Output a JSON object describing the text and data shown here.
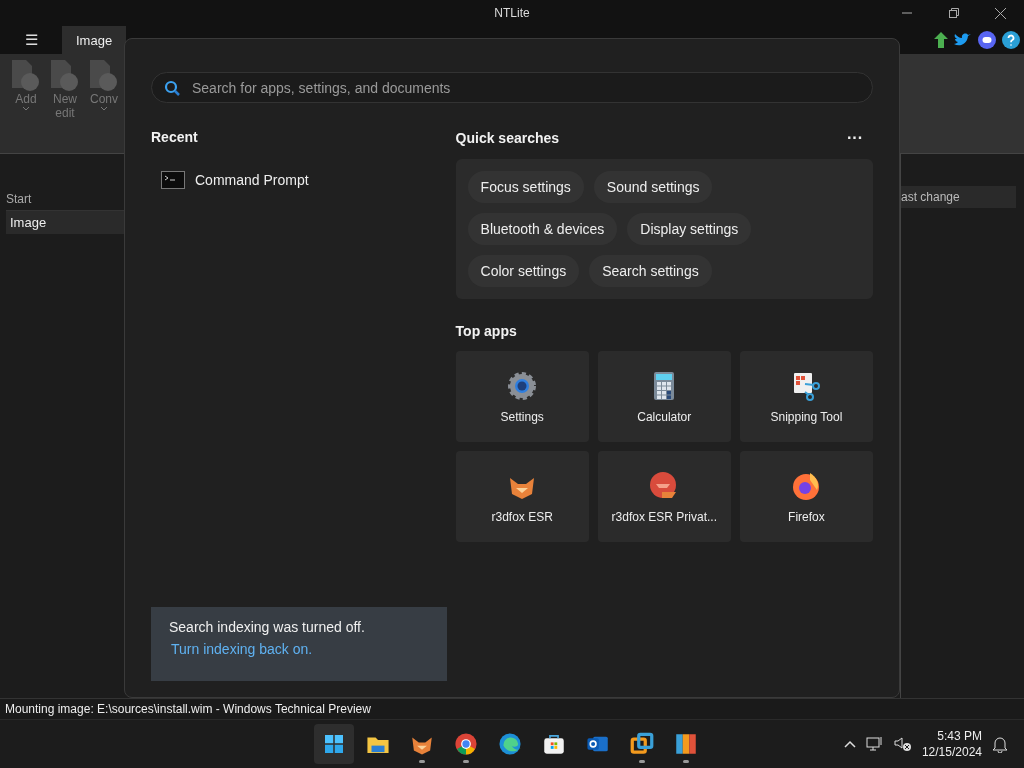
{
  "window": {
    "title": "NTLite"
  },
  "menu_button": "☰",
  "tabs": [
    {
      "label": "Image",
      "selected": true
    }
  ],
  "ribbon": [
    {
      "label": "Add",
      "dropdown": true
    },
    {
      "label": "New edit",
      "dropdown": false
    },
    {
      "label": "Conv",
      "dropdown": true
    }
  ],
  "left_pane": {
    "heading": "Start",
    "items": [
      {
        "label": "Image",
        "selected": true
      }
    ]
  },
  "right_pane": {
    "column_header": "ast change"
  },
  "status_bar": "Mounting image: E:\\sources\\install.wim - Windows Technical Preview",
  "search_panel": {
    "placeholder": "Search for apps, settings, and documents",
    "recent": {
      "heading": "Recent",
      "items": [
        {
          "label": "Command Prompt",
          "kind": "console"
        }
      ]
    },
    "quick_searches": {
      "heading": "Quick searches",
      "more": "···",
      "rows": [
        [
          "Focus settings",
          "Sound settings"
        ],
        [
          "Bluetooth & devices",
          "Display settings"
        ],
        [
          "Color settings",
          "Search settings"
        ]
      ]
    },
    "top_apps": {
      "heading": "Top apps",
      "items": [
        {
          "label": "Settings",
          "kind": "gear"
        },
        {
          "label": "Calculator",
          "kind": "calculator"
        },
        {
          "label": "Snipping Tool",
          "kind": "snip"
        },
        {
          "label": "r3dfox ESR",
          "kind": "fox"
        },
        {
          "label": "r3dfox ESR Privat...",
          "kind": "foxprivate"
        },
        {
          "label": "Firefox",
          "kind": "firefox"
        }
      ]
    },
    "notice": {
      "message": "Search indexing was turned off.",
      "link": "Turn indexing back on."
    }
  },
  "taskbar": {
    "apps": [
      {
        "kind": "start",
        "selected": true,
        "running": false
      },
      {
        "kind": "folder",
        "selected": false,
        "running": false
      },
      {
        "kind": "fox",
        "selected": false,
        "running": true
      },
      {
        "kind": "chrome",
        "selected": false,
        "running": true
      },
      {
        "kind": "edge",
        "selected": false,
        "running": false
      },
      {
        "kind": "store",
        "selected": false,
        "running": false
      },
      {
        "kind": "outlook",
        "selected": false,
        "running": false
      },
      {
        "kind": "vm",
        "selected": false,
        "running": true
      },
      {
        "kind": "archive",
        "selected": false,
        "running": true
      }
    ],
    "time": "5:43 PM",
    "date": "12/15/2024"
  }
}
